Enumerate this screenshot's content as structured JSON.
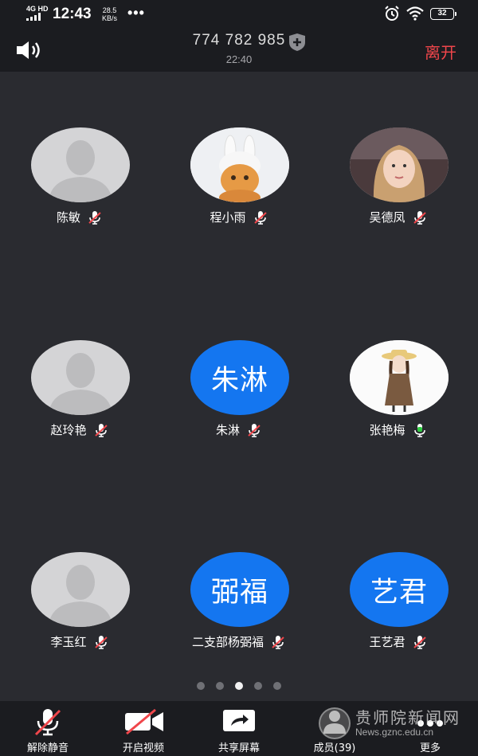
{
  "status_bar": {
    "network": "4G HD",
    "time": "12:43",
    "speed_value": "28.5",
    "speed_unit": "KB/s",
    "more": "•••",
    "battery": "32"
  },
  "header": {
    "meeting_id": "774 782 985",
    "duration": "22:40",
    "leave_label": "离开"
  },
  "participants": [
    {
      "name": "陈敏",
      "avatar_type": "default",
      "mic": "muted"
    },
    {
      "name": "程小雨",
      "avatar_type": "photo-cat",
      "mic": "muted"
    },
    {
      "name": "吴德凤",
      "avatar_type": "photo-girl",
      "mic": "muted"
    },
    {
      "name": "赵玲艳",
      "avatar_type": "default",
      "mic": "muted"
    },
    {
      "name": "朱淋",
      "avatar_type": "text",
      "avatar_text": "朱淋",
      "mic": "muted"
    },
    {
      "name": "张艳梅",
      "avatar_type": "photo-cartoon",
      "mic": "speaking"
    },
    {
      "name": "李玉红",
      "avatar_type": "default",
      "mic": "muted"
    },
    {
      "name": "二支部杨弼福",
      "avatar_type": "text",
      "avatar_text": "弼福",
      "mic": "muted"
    },
    {
      "name": "王艺君",
      "avatar_type": "text",
      "avatar_text": "艺君",
      "mic": "muted"
    }
  ],
  "pager": {
    "count": 5,
    "active_index": 2
  },
  "toolbar": {
    "unmute": "解除静音",
    "video": "开启视频",
    "share": "共享屏幕",
    "members": "成员(39)",
    "more": "更多"
  },
  "watermark": {
    "title": "贵师院新闻网",
    "url": "News.gznc.edu.cn"
  },
  "colors": {
    "accent_blue": "#1476f0",
    "leave_red": "#f0464b",
    "mute_red": "#f0464b",
    "speaking_green": "#2ecc40",
    "background": "#2a2b30"
  }
}
